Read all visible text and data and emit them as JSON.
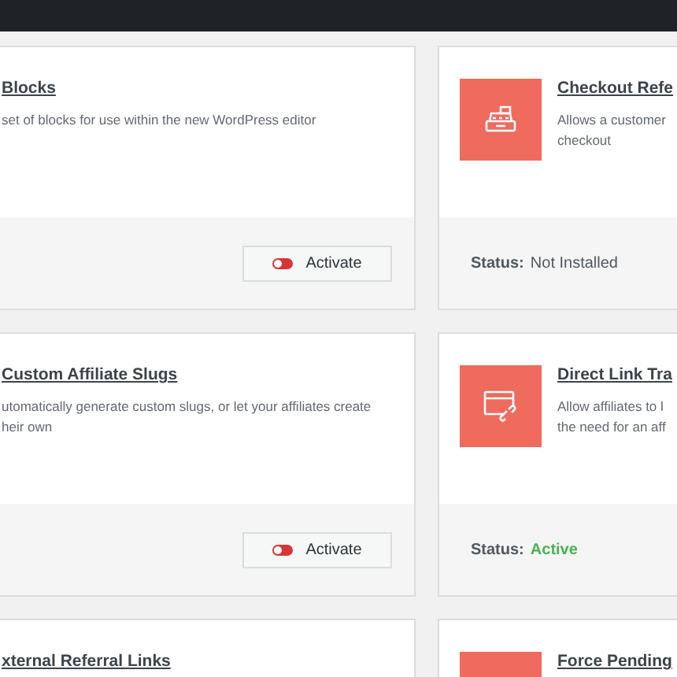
{
  "rows": [
    {
      "left": {
        "title": "Blocks",
        "description": "set of blocks for use within the new WordPress editor",
        "footer": {
          "kind": "button",
          "label": "Activate",
          "on": false
        }
      },
      "right": {
        "title": "Checkout Refe",
        "description": "Allows a customer\ncheckout",
        "footer": {
          "kind": "status",
          "label": "Status:",
          "value": "Not Installed",
          "active": false
        }
      }
    },
    {
      "left": {
        "title": "Custom Affiliate Slugs",
        "description": "utomatically generate custom slugs, or let your affiliates create\nheir own",
        "footer": {
          "kind": "button",
          "label": "Activate",
          "on": false
        }
      },
      "right": {
        "title": "Direct Link Tra",
        "description": "Allow affiliates to l\nthe need for an aff",
        "footer": {
          "kind": "status",
          "label": "Status:",
          "value": "Active",
          "active": true
        }
      }
    },
    {
      "left": {
        "title": "xternal Referral Links"
      },
      "right": {
        "title": "Force Pending"
      }
    }
  ]
}
